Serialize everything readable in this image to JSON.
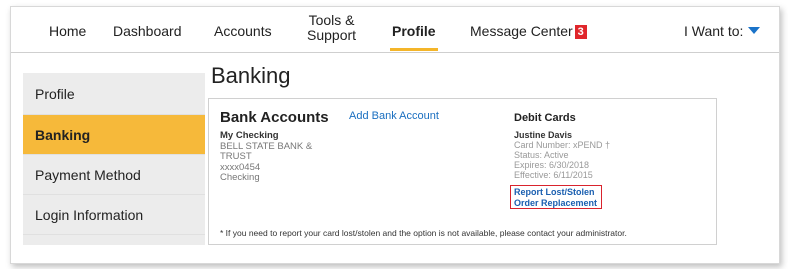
{
  "nav": {
    "items": [
      {
        "label": "Home"
      },
      {
        "label": "Dashboard"
      },
      {
        "label": "Accounts"
      },
      {
        "label_line1": "Tools &",
        "label_line2": "Support"
      },
      {
        "label": "Profile"
      },
      {
        "label": "Message Center",
        "badge": "3"
      }
    ],
    "i_want_to": "I Want to:"
  },
  "sidebar": {
    "items": [
      {
        "label": "Profile"
      },
      {
        "label": "Banking"
      },
      {
        "label": "Payment Method"
      },
      {
        "label": "Login Information"
      }
    ]
  },
  "main": {
    "title": "Banking",
    "bank_accounts": {
      "heading": "Bank Accounts",
      "add_link": "Add Bank Account",
      "account": {
        "name": "My Checking",
        "bank_line1": "BELL STATE BANK &",
        "bank_line2": "TRUST",
        "number": "xxxx0454",
        "type": "Checking"
      }
    },
    "debit_cards": {
      "heading": "Debit Cards",
      "holder": "Justine Davis",
      "card_number": "Card Number: xPEND †",
      "status": "Status: Active",
      "expires": "Expires: 6/30/2018",
      "effective": "Effective: 6/11/2015",
      "report_link": "Report Lost/Stolen",
      "order_link": "Order Replacement"
    },
    "footnote": "* If you need to report your card lost/stolen and the option is not available, please contact your administrator."
  },
  "colors": {
    "accent": "#f6b93a",
    "link": "#1a6fc0",
    "badge": "#e0262b",
    "highlight_box": "#d9232d"
  }
}
